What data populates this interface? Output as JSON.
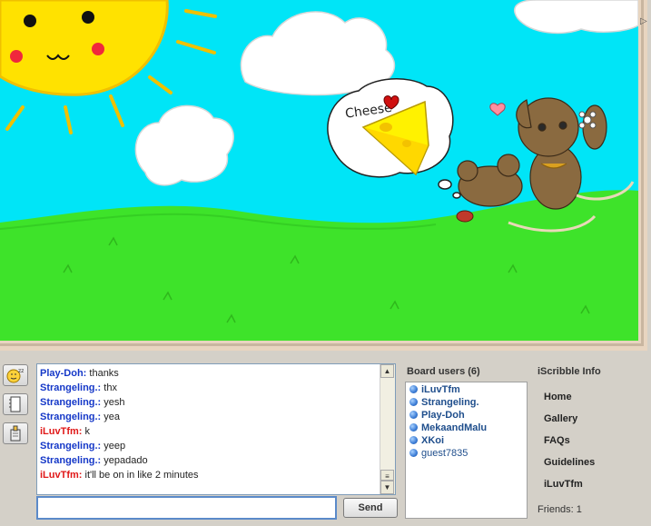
{
  "colors": {
    "sky": "#00e5f7",
    "grass": "#3ee32a",
    "sun": "#ffe200",
    "own_user": "#e01818",
    "other_user": "#1538c8"
  },
  "drawing": {
    "speech_text": "Cheese"
  },
  "chat": {
    "messages": [
      {
        "user": "Play-Doh:",
        "text": "thanks",
        "color": "#1538c8"
      },
      {
        "user": "Strangeling.:",
        "text": "thx",
        "color": "#1538c8"
      },
      {
        "user": "Strangeling.:",
        "text": "yesh",
        "color": "#1538c8"
      },
      {
        "user": "Strangeling.:",
        "text": "yea",
        "color": "#1538c8"
      },
      {
        "user": "iLuvTfm:",
        "text": "k",
        "color": "#e01818"
      },
      {
        "user": "Strangeling.:",
        "text": "yeep",
        "color": "#1538c8"
      },
      {
        "user": "Strangeling.:",
        "text": "yepadado",
        "color": "#1538c8"
      },
      {
        "user": "iLuvTfm:",
        "text": "it'll be on in like 2 minutes",
        "color": "#e01818"
      }
    ],
    "input_value": "",
    "send_label": "Send"
  },
  "board_users": {
    "header": "Board users (6)",
    "users": [
      {
        "name": "iLuvTfm",
        "bold": true
      },
      {
        "name": "Strangeling.",
        "bold": true
      },
      {
        "name": "Play-Doh",
        "bold": true
      },
      {
        "name": "MekaandMalu",
        "bold": true
      },
      {
        "name": "XKoi",
        "bold": true
      },
      {
        "name": "guest7835",
        "bold": false
      }
    ]
  },
  "info": {
    "title": "iScribble Info",
    "links": [
      "Home",
      "Gallery",
      "FAQs",
      "Guidelines",
      "iLuvTfm"
    ],
    "friends": "Friends: 1"
  },
  "tools": [
    "smiley-sleep-icon",
    "notebook-icon",
    "pencil-sharpener-icon"
  ]
}
